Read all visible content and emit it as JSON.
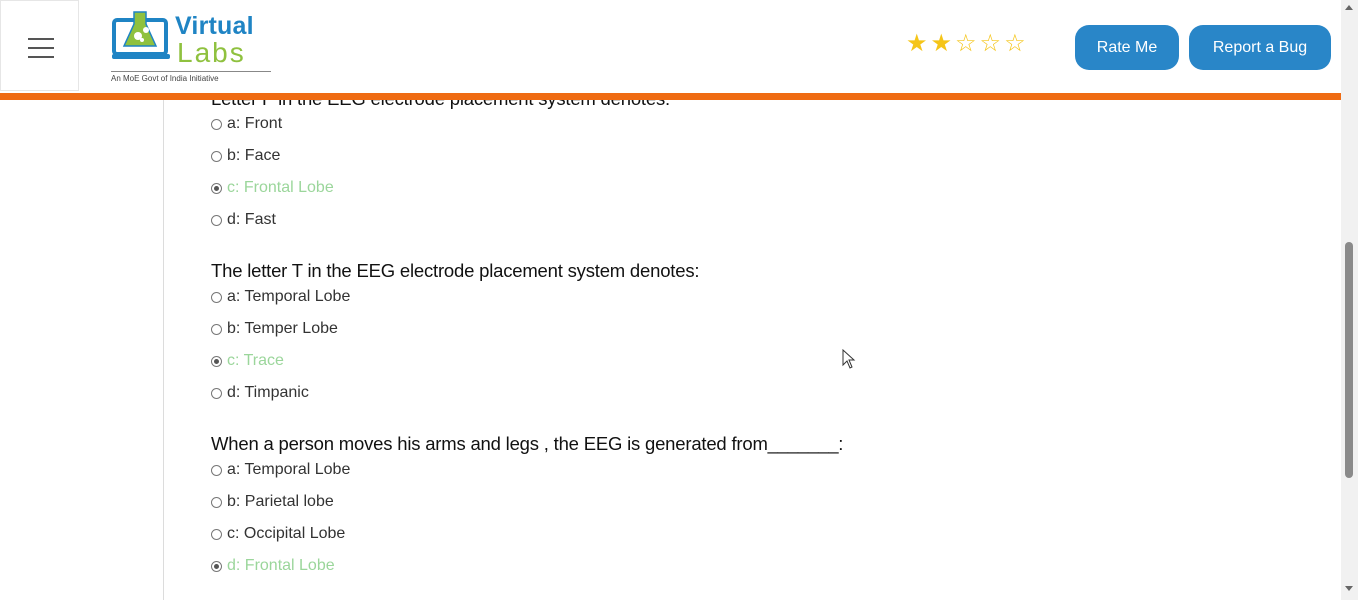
{
  "header": {
    "logo": {
      "word1": "Virtual",
      "word2": "Labs",
      "tagline": "An MoE Govt of India Initiative"
    },
    "rating": {
      "filled": 2,
      "total": 5
    },
    "rate_label": "Rate Me",
    "bug_label": "Report a Bug"
  },
  "colors": {
    "accent": "#2986c8",
    "orange_bar": "#ef6b13",
    "correct_option": "#9bd69b"
  },
  "questions": [
    {
      "text": "Letter F in the EEG electrode placement system denotes:",
      "options": [
        {
          "label": "a: Front",
          "selected": false
        },
        {
          "label": "b: Face",
          "selected": false
        },
        {
          "label": "c: Frontal Lobe",
          "selected": true
        },
        {
          "label": "d: Fast",
          "selected": false
        }
      ]
    },
    {
      "text": "The letter T in the EEG electrode placement system denotes:",
      "options": [
        {
          "label": "a: Temporal Lobe",
          "selected": false
        },
        {
          "label": "b: Temper Lobe",
          "selected": false
        },
        {
          "label": "c: Trace",
          "selected": true
        },
        {
          "label": "d: Timpanic",
          "selected": false
        }
      ]
    },
    {
      "text": "When a person moves his arms and legs , the EEG is generated from_______:",
      "options": [
        {
          "label": "a: Temporal Lobe",
          "selected": false
        },
        {
          "label": "b: Parietal lobe",
          "selected": false
        },
        {
          "label": "c: Occipital Lobe",
          "selected": false
        },
        {
          "label": "d: Frontal Lobe",
          "selected": true
        }
      ]
    }
  ]
}
